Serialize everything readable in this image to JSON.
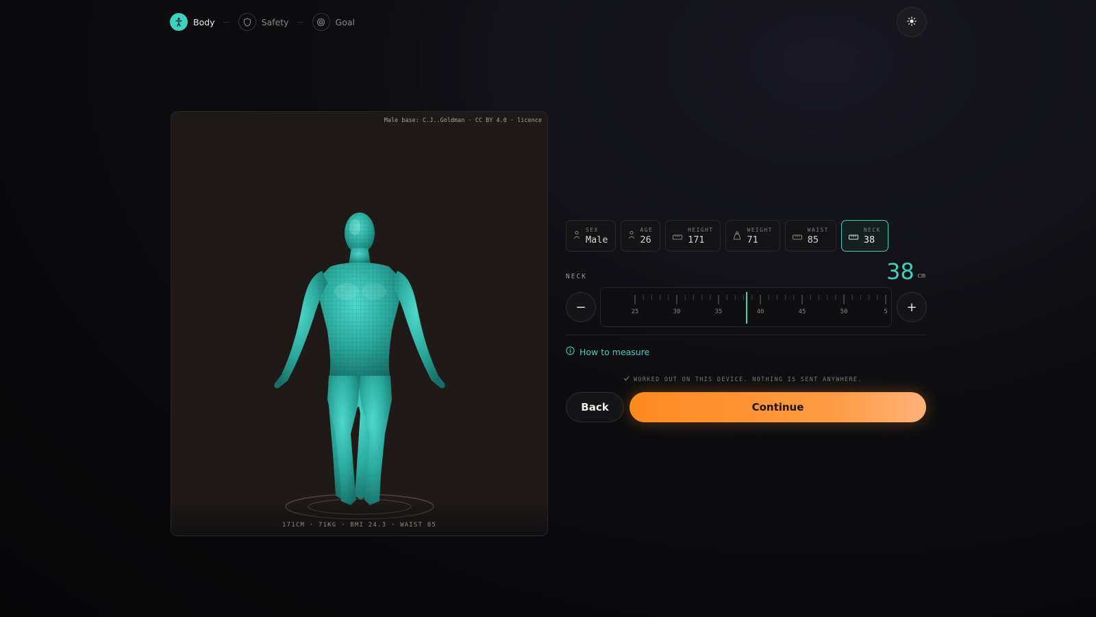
{
  "steps": [
    {
      "label": "Body",
      "icon": "figure-icon",
      "state": "active"
    },
    {
      "label": "Safety",
      "icon": "shield-icon",
      "state": "idle"
    },
    {
      "label": "Goal",
      "icon": "target-icon",
      "state": "idle"
    }
  ],
  "theme_toggle": {
    "icon": "sun-icon"
  },
  "viewer": {
    "credit": "Male base: C.J..Goldman · CC BY 4.0 · licence",
    "stats": "171CM · 71KG · BMI 24.3 · WAIST 85",
    "model_color": "#2fb8aa"
  },
  "chips": [
    {
      "label": "SEX",
      "value": "Male",
      "icon": "person-icon"
    },
    {
      "label": "AGE",
      "value": "26",
      "icon": "person-icon"
    },
    {
      "label": "HEIGHT",
      "value": "171",
      "icon": "ruler-icon"
    },
    {
      "label": "WEIGHT",
      "value": "71",
      "icon": "weight-icon"
    },
    {
      "label": "WAIST",
      "value": "85",
      "icon": "ruler-icon"
    },
    {
      "label": "NECK",
      "value": "38",
      "icon": "ruler-icon",
      "active": true
    }
  ],
  "measure": {
    "label": "NECK",
    "value": "38",
    "unit": "cm",
    "decrement": "−",
    "increment": "+",
    "ruler_ticks": [
      "25",
      "30",
      "35",
      "40",
      "45",
      "50",
      "5"
    ]
  },
  "how_to_measure": "How to measure",
  "privacy_note": "WORKED OUT ON THIS DEVICE. NOTHING IS SENT ANYWHERE.",
  "actions": {
    "back": "Back",
    "continue": "Continue"
  },
  "colors": {
    "accent": "#3fd1bd",
    "cta": "#ff8a1e",
    "background": "#0d0d10"
  }
}
